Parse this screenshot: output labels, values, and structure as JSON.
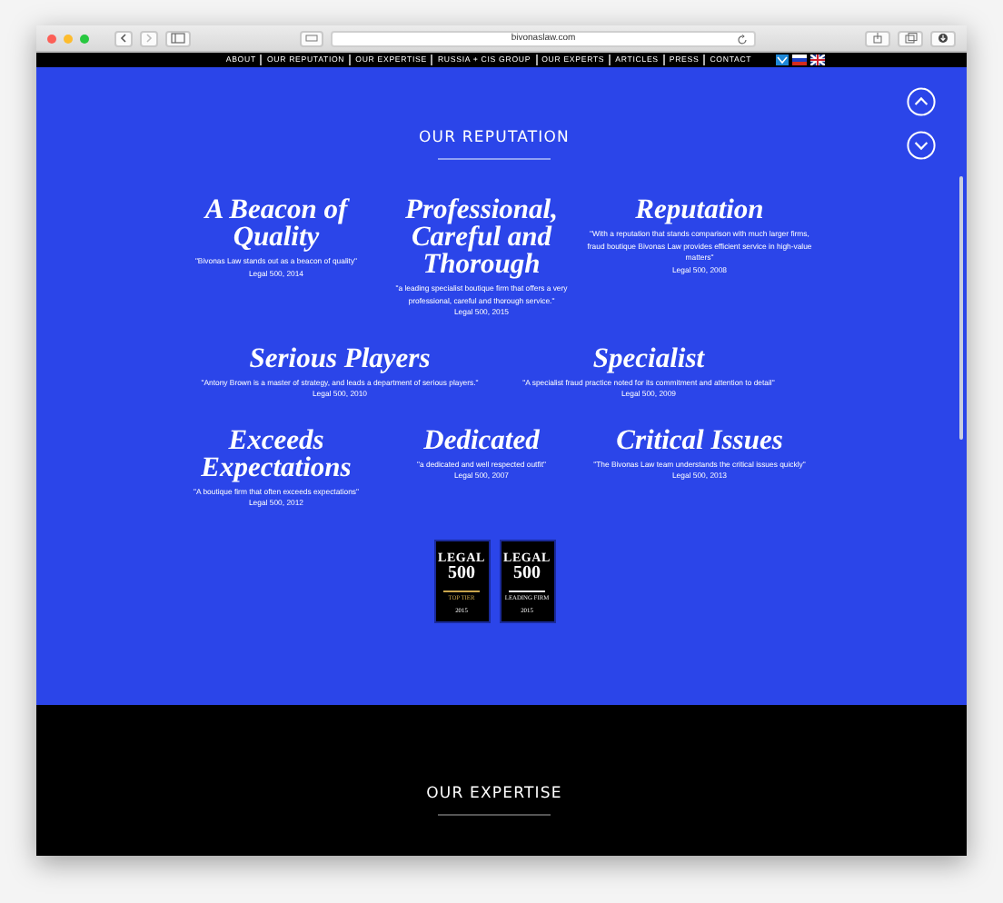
{
  "browser": {
    "url": "bivonaslaw.com"
  },
  "nav": {
    "items": [
      "ABOUT",
      "OUR REPUTATION",
      "OUR EXPERTISE",
      "RUSSIA + CIS GROUP",
      "OUR EXPERTS",
      "ARTICLES",
      "PRESS",
      "CONTACT"
    ]
  },
  "reputation": {
    "title": "OUR REPUTATION",
    "rows": [
      [
        {
          "heading": "A Beacon of Quality",
          "quote": "\"Bivonas Law stands out as a beacon of quality\"",
          "source": "Legal 500, 2014"
        },
        {
          "heading": "Professional, Careful and Thorough",
          "quote": "\"a leading specialist boutique firm that offers a very professional, careful and thorough service.\"",
          "source": "Legal 500, 2015"
        },
        {
          "heading": "Reputation",
          "quote": "\"With a reputation that stands comparison with much larger firms, fraud boutique Bivonas Law provides efficient service in high-value matters\"",
          "source": "Legal 500, 2008"
        }
      ],
      [
        {
          "heading": "Serious Players",
          "quote": "\"Antony Brown is a master of strategy, and leads a department of serious players.\"",
          "source": "Legal 500, 2010"
        },
        {
          "heading": "Specialist",
          "quote": "\"A specialist fraud practice noted for its commitment and attention to detail\"",
          "source": "Legal 500, 2009"
        }
      ],
      [
        {
          "heading": "Exceeds Expectations",
          "quote": "\"A boutique firm that often exceeds expectations\"",
          "source": "Legal 500, 2012"
        },
        {
          "heading": "Dedicated",
          "quote": "\"a dedicated and well respected outfit\"",
          "source": "Legal 500, 2007"
        },
        {
          "heading": "Critical Issues",
          "quote": "\"The Bivonas Law team understands the critical issues quickly\"",
          "source": "Legal 500, 2013"
        }
      ]
    ],
    "awards": [
      {
        "name": "LEGAL",
        "number": "500",
        "tier": "TOP TIER",
        "year": "2015",
        "color": "#c9a54c"
      },
      {
        "name": "LEGAL",
        "number": "500",
        "tier": "LEADING FIRM",
        "year": "2015",
        "color": "#e8e8e8"
      }
    ]
  },
  "expertise": {
    "title": "OUR EXPERTISE"
  }
}
